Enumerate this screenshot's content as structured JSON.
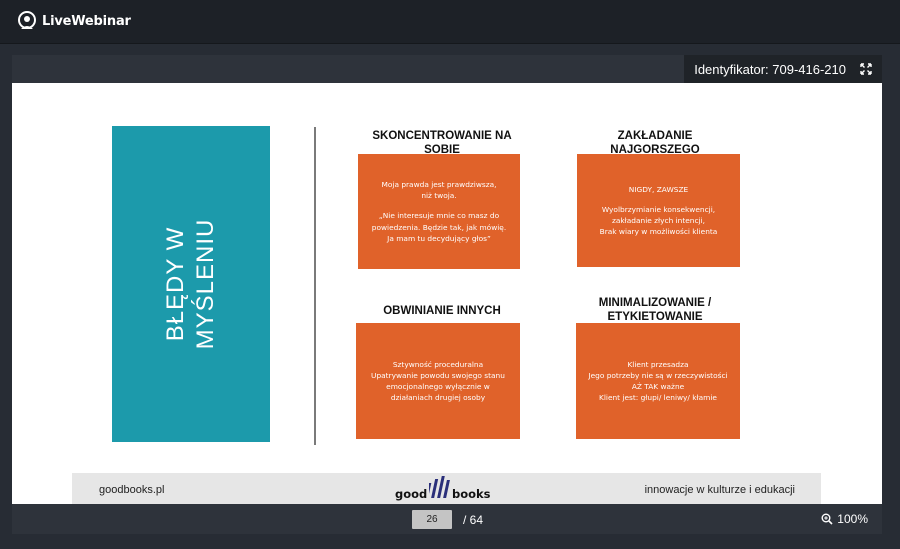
{
  "app": {
    "name": "LiveWebinar"
  },
  "session": {
    "id_label": "Identyfikator: 709-416-210"
  },
  "slide": {
    "left_title_line1": "BŁĘDY W",
    "left_title_line2": "MYŚLENIU",
    "sections": [
      {
        "heading": [
          "SKONCENTROWANIE NA",
          "SOBIE"
        ],
        "lines": [
          "Moja prawda jest prawdziwsza,",
          "niż twoja.",
          "",
          "„Nie interesuje mnie co masz do",
          "powiedzenia. Będzie tak, jak mówię.",
          "Ja mam tu decydujący głos”"
        ]
      },
      {
        "heading": [
          "ZAKŁADANIE",
          "NAJGORSZEGO"
        ],
        "lines": [
          "NIGDY, ZAWSZE",
          "",
          "Wyolbrzymianie konsekwencji,",
          "zakładanie złych intencji,",
          "Brak wiary w możliwości klienta"
        ]
      },
      {
        "heading": [
          "OBWINIANIE INNYCH"
        ],
        "lines": [
          "Sztywność proceduralna",
          "Upatrywanie powodu swojego stanu",
          "emocjonalnego wyłącznie w",
          "działaniach drugiej osoby"
        ]
      },
      {
        "heading": [
          "MINIMALIZOWANIE /",
          "ETYKIETOWANIE"
        ],
        "lines": [
          "Klient przesadza",
          "Jego potrzeby nie są w rzeczywistości",
          "AŻ TAK ważne",
          "Klient jest: głupi/ leniwy/ kłamie"
        ]
      }
    ],
    "footer": {
      "left": "goodbooks.pl",
      "logo_part1": "good",
      "logo_part2": "books",
      "right": "innowacje w kulturze i edukacji"
    }
  },
  "pagination": {
    "current": "26",
    "total": "/ 64"
  },
  "zoom": {
    "value": "100%"
  },
  "colors": {
    "teal": "#1c9aab",
    "orange": "#e0622a",
    "topbar": "#1d2127",
    "background": "#272c34"
  }
}
